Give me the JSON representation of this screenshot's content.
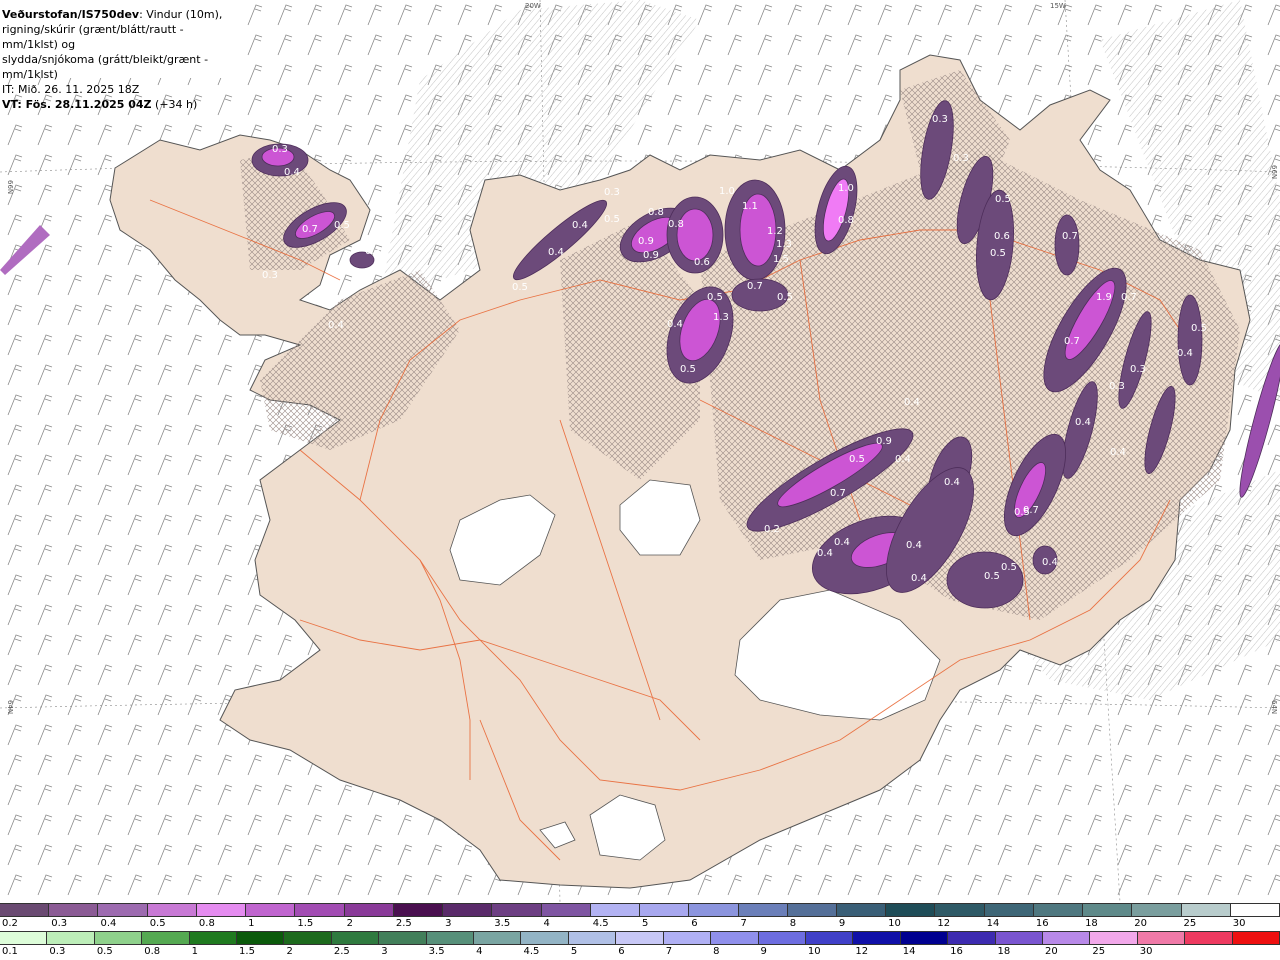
{
  "header": {
    "source": "Veðurstofan/IS750dev",
    "desc_1": ": Vindur (10m),",
    "desc_2": "rigning/skúrir (grænt/blátt/rautt - mm/1klst) og",
    "desc_3": "slydda/snjókoma (grátt/bleikt/grænt - mm/1klst)",
    "init_time": "IT: Mið. 26. 11. 2025 18Z",
    "valid_time": "VT: Fös. 28.11.2025 04Z",
    "lead": "(+34 h)"
  },
  "map": {
    "land_color": "#efdecf",
    "ice_color": "#ffffff",
    "road_color": "#e8602c",
    "precip_colors": [
      "#6c4a7a",
      "#9b4fae",
      "#cc55d4",
      "#f07bf5"
    ],
    "grid_labels": {
      "lon_20w": "20W",
      "lon_15w": "15W",
      "lat_66n_left": "66N",
      "lat_66n_right": "66N",
      "lat_64n_left": "64N",
      "lat_64n_right": "64N"
    },
    "precip_values": [
      {
        "t": "0.3"
      },
      {
        "t": "0.4"
      },
      {
        "t": "0.7"
      },
      {
        "t": "0.5"
      },
      {
        "t": "0.3"
      },
      {
        "t": "0.3"
      },
      {
        "t": "0.4"
      },
      {
        "t": "0.5"
      },
      {
        "t": "0.4"
      },
      {
        "t": "0.4"
      },
      {
        "t": "0.3"
      },
      {
        "t": "0.5"
      },
      {
        "t": "0.8"
      },
      {
        "t": "0.8"
      },
      {
        "t": "0.9"
      },
      {
        "t": "0.9"
      },
      {
        "t": "1.1"
      },
      {
        "t": "1.0"
      },
      {
        "t": "0.6"
      },
      {
        "t": "1.2"
      },
      {
        "t": "1.3"
      },
      {
        "t": "1.5"
      },
      {
        "t": "0.7"
      },
      {
        "t": "0.5"
      },
      {
        "t": "0.5"
      },
      {
        "t": "1.3"
      },
      {
        "t": "0.4"
      },
      {
        "t": "0.5"
      },
      {
        "t": "1.0"
      },
      {
        "t": "0.8"
      },
      {
        "t": "0.3"
      },
      {
        "t": "0.3"
      },
      {
        "t": "0.5"
      },
      {
        "t": "0.6"
      },
      {
        "t": "0.5"
      },
      {
        "t": "0.7"
      },
      {
        "t": "1.9"
      },
      {
        "t": "0.7"
      },
      {
        "t": "0.7"
      },
      {
        "t": "0.3"
      },
      {
        "t": "0.3"
      },
      {
        "t": "0.5"
      },
      {
        "t": "0.4"
      },
      {
        "t": "0.9"
      },
      {
        "t": "0.5"
      },
      {
        "t": "0.4"
      },
      {
        "t": "0.7"
      },
      {
        "t": "0.2"
      },
      {
        "t": "0.4"
      },
      {
        "t": "0.4"
      },
      {
        "t": "0.4"
      },
      {
        "t": "0.4"
      },
      {
        "t": "0.4"
      },
      {
        "t": "0.5"
      },
      {
        "t": "0.4"
      },
      {
        "t": "0.7"
      },
      {
        "t": "0.4"
      },
      {
        "t": "0.5"
      },
      {
        "t": "0.5"
      },
      {
        "t": "0.4"
      },
      {
        "t": "0.4"
      }
    ]
  },
  "legend": {
    "snow": {
      "colors": [
        "#6a4a72",
        "#8b5b95",
        "#9d6bb0",
        "#c879d5",
        "#e58cf0",
        "#c065cf",
        "#a24cb3",
        "#8a3a99",
        "#4a1050",
        "#5a2a6a",
        "#6d3f83",
        "#7f55a2",
        "#b3b3f3",
        "#a8a8ef",
        "#8c95de",
        "#6b7fb9",
        "#557099",
        "#3a5f77",
        "#1f4d58",
        "#2f5a66",
        "#3f6777",
        "#4f7880",
        "#5f8a8a",
        "#7a9e9e",
        "#b8cccc",
        "#ffffff"
      ],
      "labels": [
        "0.2",
        "0.3",
        "0.4",
        "0.5",
        "0.8",
        "1",
        "1.5",
        "2",
        "2.5",
        "3",
        "3.5",
        "4",
        "4.5",
        "5",
        "6",
        "7",
        "8",
        "9",
        "10",
        "12",
        "14",
        "16",
        "18",
        "20",
        "25",
        "30"
      ]
    },
    "rain": {
      "colors": [
        "#ddfdd9",
        "#bdeeb9",
        "#8fd18c",
        "#55a952",
        "#1f7a1f",
        "#0b5a0b",
        "#1d6a1d",
        "#2f7a3f",
        "#427f5a",
        "#57907a",
        "#7aa5a2",
        "#93b4c5",
        "#b0c0e6",
        "#c8c8f6",
        "#b0b0f4",
        "#9090ec",
        "#6d6de0",
        "#4040c8",
        "#1010a8",
        "#000090",
        "#3d2bb0",
        "#7a55d0",
        "#b889e8",
        "#f2a8ea",
        "#f07aa8",
        "#ee3a60",
        "#ee1010"
      ],
      "labels": [
        "0.1",
        "0.3",
        "0.5",
        "0.8",
        "1",
        "1.5",
        "2",
        "2.5",
        "3",
        "3.5",
        "4",
        "4.5",
        "5",
        "6",
        "7",
        "8",
        "9",
        "10",
        "12",
        "14",
        "16",
        "18",
        "20",
        "25",
        "30"
      ]
    }
  }
}
